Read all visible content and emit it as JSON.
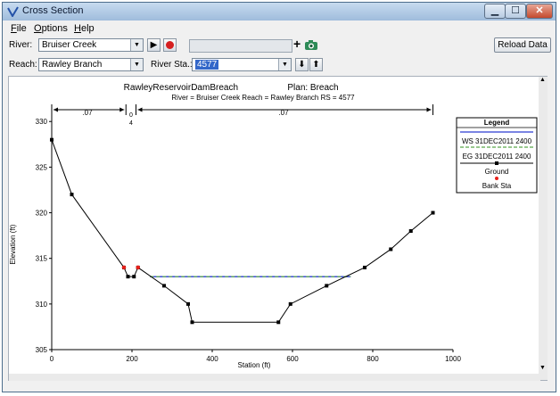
{
  "window": {
    "title": "Cross Section"
  },
  "menu": {
    "file": "File",
    "options": "Options",
    "help": "Help"
  },
  "controls": {
    "river_label": "River:",
    "river_value": "Bruiser Creek",
    "reach_label": "Reach:",
    "reach_value": "Rawley Branch",
    "river_sta_label": "River Sta.:",
    "river_sta_value": "4577",
    "plus_symbol": "+",
    "reload_label": "Reload Data"
  },
  "plot": {
    "plan_title": "RawleyReservoirDamBreach",
    "plan_name": "Plan: Breach",
    "subtitle": "River = Bruiser Creek   Reach = Rawley Branch      RS = 4577",
    "n_left": ".07",
    "n_mid_a": "0",
    "n_mid_b": "4",
    "n_right": ".07"
  },
  "legend": {
    "title": "Legend",
    "items": [
      {
        "label": "WS 31DEC2011 2400",
        "color": "#2a3ad2"
      },
      {
        "label": "EG 31DEC2011 2400",
        "color": "#5aa84a"
      },
      {
        "label": "Ground",
        "color": "#000000"
      },
      {
        "label": "Bank Sta",
        "color": "#e8201a"
      }
    ]
  },
  "chart_data": {
    "type": "line",
    "xlabel": "Station (ft)",
    "ylabel": "Elevation (ft)",
    "xlim": [
      0,
      1000
    ],
    "ylim": [
      305,
      331
    ],
    "xticks": [
      0,
      200,
      400,
      600,
      800,
      1000
    ],
    "yticks": [
      305,
      310,
      315,
      320,
      325,
      330
    ],
    "series": [
      {
        "name": "Ground",
        "x": [
          0,
          50,
          180,
          190,
          205,
          215,
          280,
          340,
          350,
          565,
          595,
          685,
          780,
          845,
          895,
          950
        ],
        "y": [
          328,
          322,
          314,
          313,
          313,
          314,
          312,
          310,
          308,
          308,
          310,
          312,
          314,
          316,
          318,
          320
        ]
      },
      {
        "name": "Bank Sta",
        "x": [
          180,
          215
        ],
        "y": [
          314,
          314
        ]
      },
      {
        "name": "WS 31DEC2011 2400",
        "x": [
          245,
          745
        ],
        "y": [
          313,
          313
        ]
      },
      {
        "name": "EG 31DEC2011 2400",
        "x": [
          245,
          745
        ],
        "y": [
          313,
          313
        ]
      }
    ],
    "manning_breaks": [
      0,
      185,
      210,
      950
    ]
  }
}
